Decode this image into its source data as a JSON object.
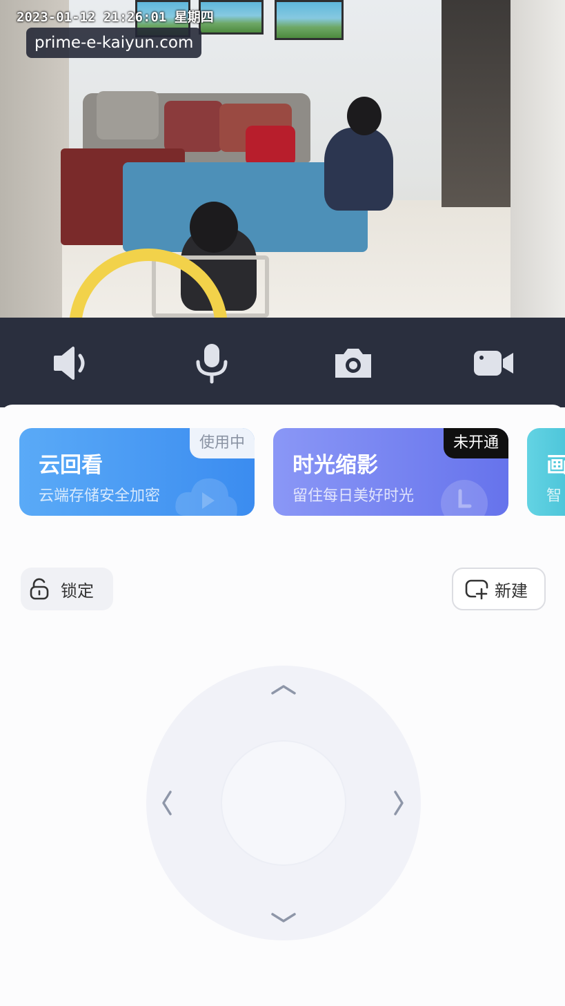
{
  "video": {
    "timestamp": "2023-01-12 21:26:01 星期四",
    "watermark": "prime-e-kaiyun.com"
  },
  "controls": [
    {
      "name": "speaker-icon"
    },
    {
      "name": "microphone-icon"
    },
    {
      "name": "camera-icon"
    },
    {
      "name": "video-record-icon"
    }
  ],
  "cards": [
    {
      "title": "云回看",
      "subtitle": "云端存储安全加密",
      "badge": "使用中",
      "colors": [
        "#4aa3f5",
        "#3d8ff0"
      ]
    },
    {
      "title": "时光缩影",
      "subtitle": "留住每日美好时光",
      "badge": "未开通",
      "colors": [
        "#7d8cf5",
        "#6a78ee"
      ]
    },
    {
      "title": "画",
      "subtitle": "智",
      "colors": [
        "#5dd0e0",
        "#48c3d8"
      ]
    }
  ],
  "actions": {
    "lock_label": "锁定",
    "new_label": "新建"
  },
  "colors": {
    "control_bar": "#2a2f3e",
    "panel_bg": "#fcfcfd",
    "icon": "#dfe2ea"
  }
}
